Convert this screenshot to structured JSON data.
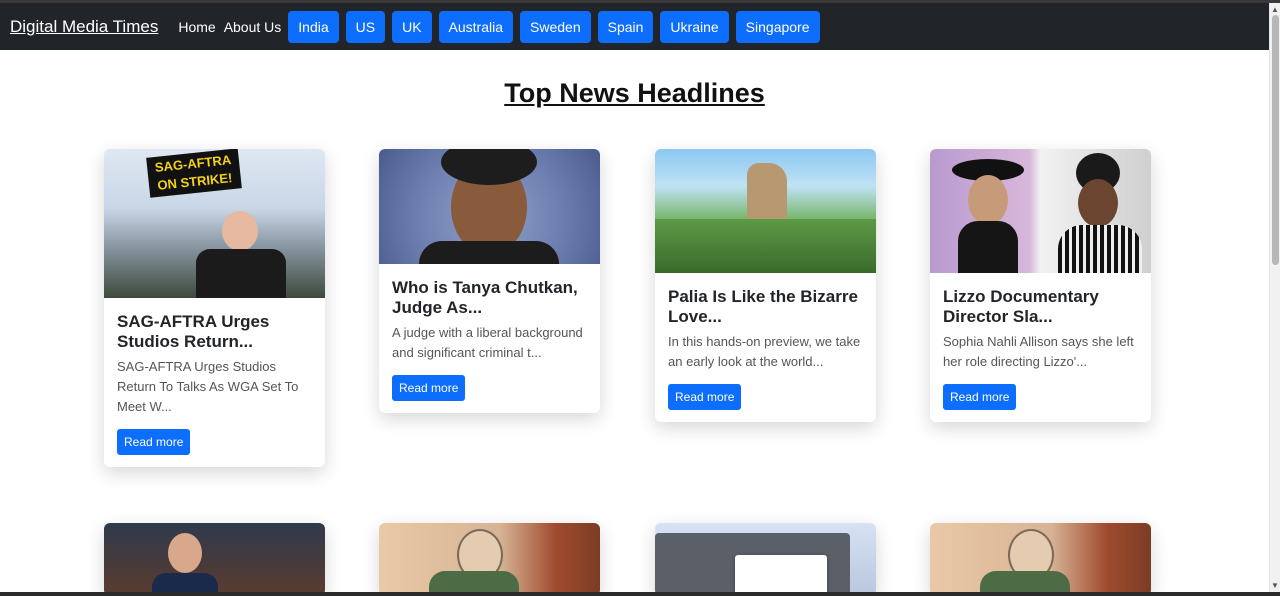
{
  "nav": {
    "brand": "Digital Media Times",
    "links": [
      "Home",
      "About Us"
    ],
    "countries": [
      "India",
      "US",
      "UK",
      "Australia",
      "Sweden",
      "Spain",
      "Ukraine",
      "Singapore"
    ]
  },
  "page_title": "Top News Headlines",
  "read_more_label": "Read more",
  "cards": [
    {
      "title": "SAG-AFTRA Urges Studios Return...",
      "text": "SAG-AFTRA Urges Studios Return To Talks As WGA Set To Meet W...",
      "image_sign_text": "SAG-AFTRA ON STRIKE!"
    },
    {
      "title": "Who is Tanya Chutkan, Judge As...",
      "text": "A judge with a liberal background and significant criminal t..."
    },
    {
      "title": "Palia Is Like the Bizarre Love...",
      "text": "In this hands-on preview, we take an early look at the world..."
    },
    {
      "title": "Lizzo Documentary Director Sla...",
      "text": "Sophia Nahli Allison says she left her role directing Lizzo'..."
    }
  ],
  "colors": {
    "navbar": "#212529",
    "primary": "#0d6efd"
  }
}
